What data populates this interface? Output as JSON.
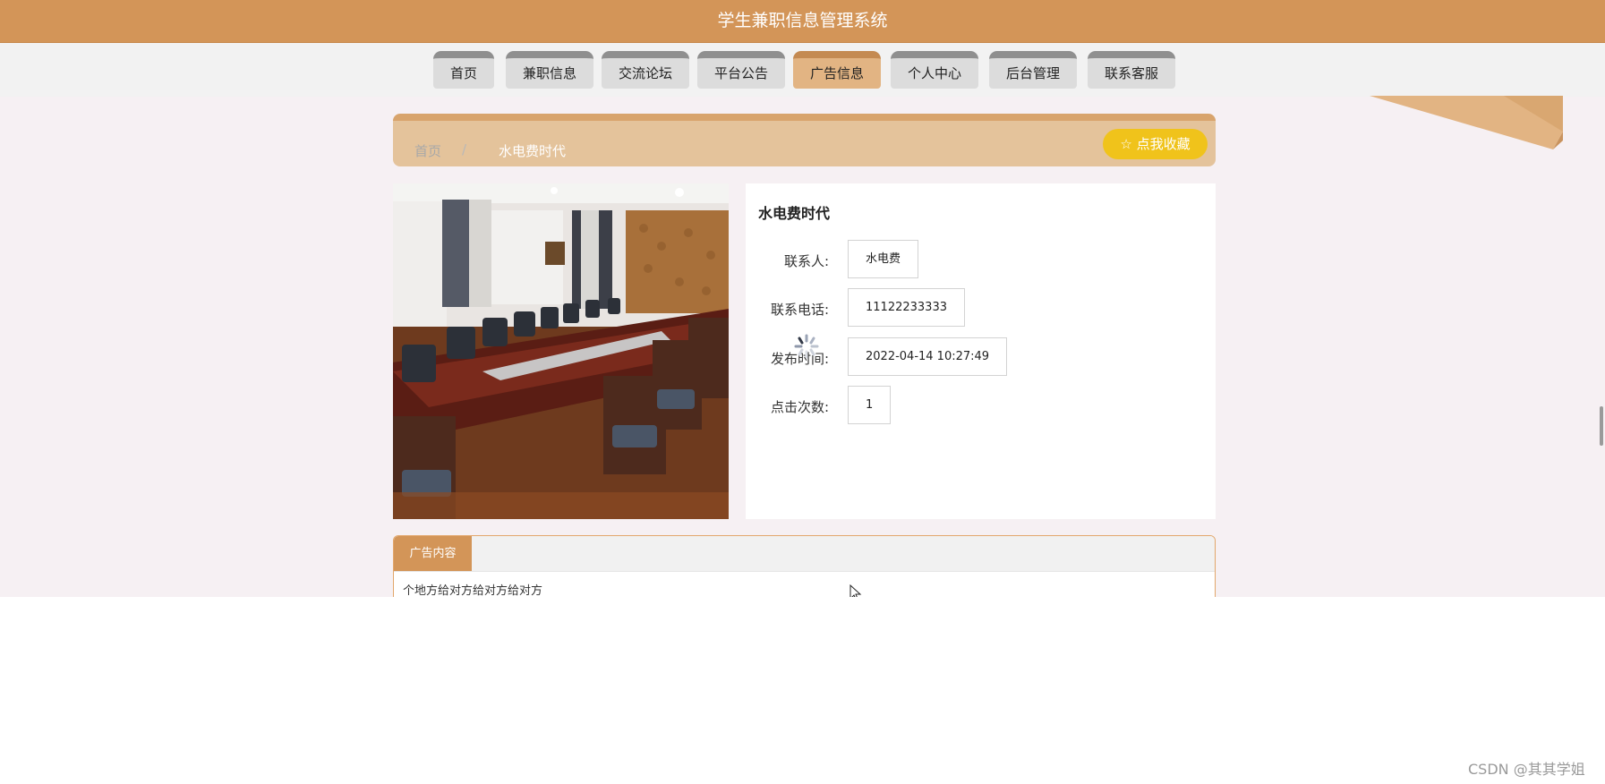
{
  "header": {
    "title": "学生兼职信息管理系统"
  },
  "nav": {
    "items": [
      {
        "label": "首页"
      },
      {
        "label": "兼职信息"
      },
      {
        "label": "交流论坛"
      },
      {
        "label": "平台公告"
      },
      {
        "label": "广告信息",
        "active": true
      },
      {
        "label": "个人中心"
      },
      {
        "label": "后台管理"
      },
      {
        "label": "联系客服"
      }
    ]
  },
  "breadcrumb": {
    "home": "首页",
    "separator": "/",
    "current": "水电费时代"
  },
  "favorite_button": {
    "label": "☆ 点我收藏"
  },
  "detail": {
    "title": "水电费时代",
    "fields": [
      {
        "label": "联系人:",
        "value": "水电费"
      },
      {
        "label": "联系电话:",
        "value": "11122233333"
      },
      {
        "label": "发布时间:",
        "value": "2022-04-14 10:27:49"
      },
      {
        "label": "点击次数:",
        "value": "1"
      }
    ]
  },
  "content": {
    "tab_label": "广告内容",
    "text": "个地方给对方给对方给对方"
  },
  "watermark": "CSDN @其其学姐",
  "colors": {
    "header_bg": "#d39558",
    "active_tab": "#e2b483",
    "breadcrumb_bg": "#e4c39b",
    "favorite_btn": "#f0c31b"
  }
}
